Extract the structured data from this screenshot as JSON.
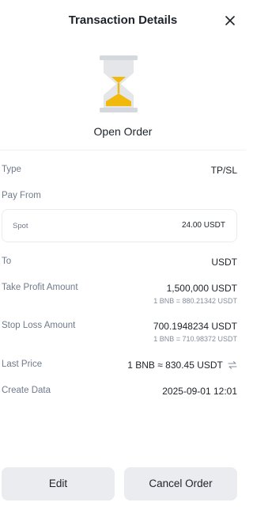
{
  "header": {
    "title": "Transaction Details"
  },
  "status": {
    "title": "Open Order"
  },
  "details": {
    "type_label": "Type",
    "type_value": "TP/SL",
    "pay_from_label": "Pay From",
    "spot_label": "Spot",
    "spot_value": "24.00 USDT",
    "to_label": "To",
    "to_value": "USDT",
    "take_profit_label": "Take Profit Amount",
    "take_profit_value": "1,500,000 USDT",
    "take_profit_rate": "1 BNB = 880.21342 USDT",
    "stop_loss_label": "Stop Loss Amount",
    "stop_loss_value": "700.1948234 USDT",
    "stop_loss_rate": "1 BNB = 710.98372 USDT",
    "last_price_label": "Last Price",
    "last_price_value": "1 BNB ≈ 830.45 USDT",
    "create_date_label": "Create Data",
    "create_date_value": "2025-09-01 12:01"
  },
  "actions": {
    "edit_label": "Edit",
    "cancel_label": "Cancel Order"
  },
  "icons": {
    "close": "close-icon",
    "hourglass": "hourglass-icon",
    "swap": "swap-icon"
  },
  "colors": {
    "accent": "#f0b90b",
    "icon_gray": "#d5d8dc",
    "button_bg": "#eaecef"
  }
}
